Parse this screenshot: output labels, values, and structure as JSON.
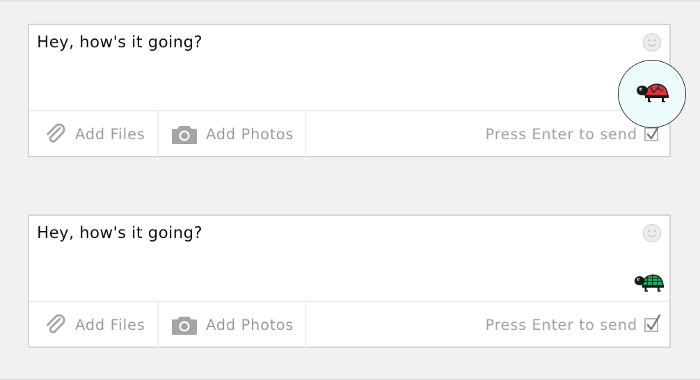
{
  "composers": [
    {
      "message_text": "Hey, how's it going?",
      "add_files_label": "Add Files",
      "add_photos_label": "Add Photos",
      "enter_to_send_label": "Press Enter to send",
      "enter_to_send_checked": true,
      "turtle_shell_color": "#d9333e",
      "icons": [
        "smiley-icon",
        "turtle-icon",
        "paperclip-icon",
        "camera-icon",
        "checkmark-icon"
      ]
    },
    {
      "message_text": "Hey, how's it going?",
      "add_files_label": "Add Files",
      "add_photos_label": "Add Photos",
      "enter_to_send_label": "Press Enter to send",
      "enter_to_send_checked": true,
      "turtle_shell_color": "#22a85a",
      "icons": [
        "smiley-icon",
        "turtle-icon",
        "paperclip-icon",
        "camera-icon",
        "checkmark-icon"
      ]
    }
  ],
  "colors": {
    "background": "#f1f1f1",
    "muted_text": "#9a9a9a",
    "magnifier_fill": "#eefbfd"
  }
}
